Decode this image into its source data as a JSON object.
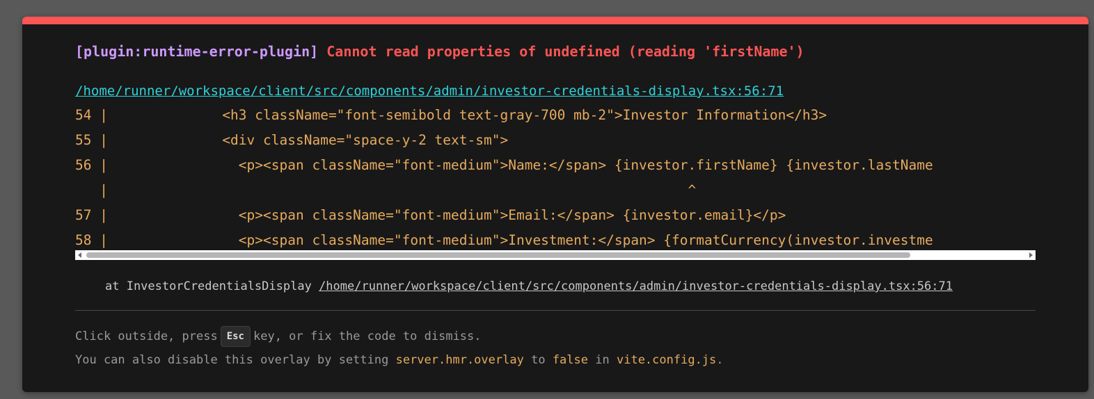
{
  "error": {
    "plugin": "[plugin:runtime-error-plugin]",
    "message": "Cannot read properties of undefined (reading 'firstName')",
    "file": "/home/runner/workspace/client/src/components/admin/investor-credentials-display.tsx:56:71"
  },
  "frame": {
    "lines": [
      "54 |              <h3 className=\"font-semibold text-gray-700 mb-2\">Investor Information</h3>",
      "55 |              <div className=\"space-y-2 text-sm\">",
      "56 |                <p><span className=\"font-medium\">Name:</span> {investor.firstName} {investor.lastName",
      "   |                                                                       ^",
      "57 |                <p><span className=\"font-medium\">Email:</span> {investor.email}</p>",
      "58 |                <p><span className=\"font-medium\">Investment:</span> {formatCurrency(investor.investme"
    ]
  },
  "stack": {
    "prefix": "at InvestorCredentialsDisplay",
    "link": "/home/runner/workspace/client/src/components/admin/investor-credentials-display.tsx:56:71"
  },
  "tip": {
    "line1_before": "Click outside, press",
    "key": "Esc",
    "line1_after": "key, or fix the code to dismiss.",
    "line2_before": "You can also disable this overlay by setting",
    "setting": "server.hmr.overlay",
    "line2_mid1": "to",
    "value": "false",
    "line2_mid2": "in",
    "config": "vite.config.js",
    "line2_end": "."
  },
  "colors": {
    "accent_bar": "#ff5555",
    "plugin": "#cc99ff",
    "error": "#ff5555",
    "link": "#2fd1d8",
    "code": "#e6ab5e"
  }
}
